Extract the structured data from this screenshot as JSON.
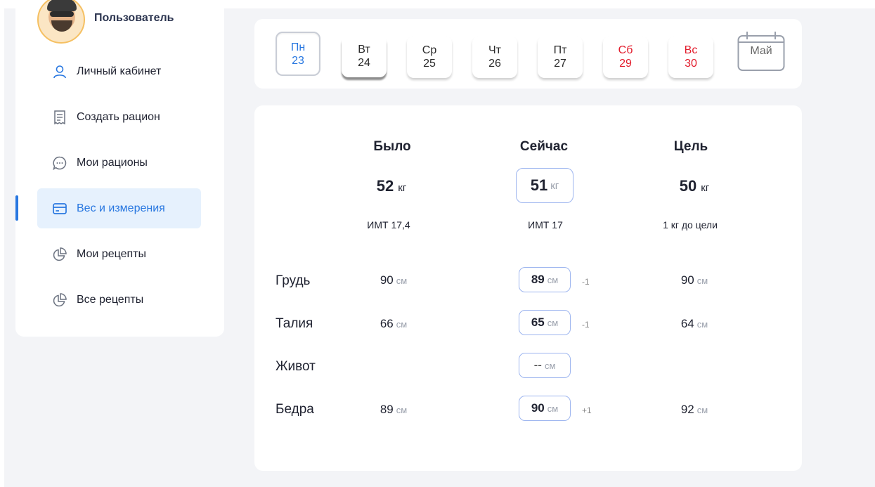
{
  "user": {
    "name": "Пользователь"
  },
  "nav": [
    {
      "label": "Личный кабинет",
      "icon": "user-icon"
    },
    {
      "label": "Создать рацион",
      "icon": "receipt-icon"
    },
    {
      "label": "Мои рационы",
      "icon": "chat-bubble-icon"
    },
    {
      "label": "Вес и измерения",
      "icon": "card-icon",
      "active": true
    },
    {
      "label": "Мои рецепты",
      "icon": "pie-chart-icon"
    },
    {
      "label": "Все рецепты",
      "icon": "pie-chart-icon"
    }
  ],
  "days": [
    {
      "name": "Пн",
      "num": "23",
      "selected": true
    },
    {
      "name": "Вт",
      "num": "24"
    },
    {
      "name": "Ср",
      "num": "25"
    },
    {
      "name": "Чт",
      "num": "26"
    },
    {
      "name": "Пт",
      "num": "27"
    },
    {
      "name": "Сб",
      "num": "29",
      "weekend": true
    },
    {
      "name": "Вс",
      "num": "30",
      "weekend": true
    }
  ],
  "month": "Май",
  "columns": {
    "was": "Было",
    "now": "Сейчас",
    "goal": "Цель"
  },
  "weight": {
    "was": "52",
    "now": "51",
    "goal": "50",
    "unit": "кг",
    "was_bmi": "ИМТ 17,4",
    "now_bmi": "ИМТ 17",
    "goal_note": "1 кг до цели"
  },
  "measure_unit": "см",
  "measurements": [
    {
      "label": "Грудь",
      "was": "90",
      "now": "89",
      "delta": "-1",
      "goal": "90"
    },
    {
      "label": "Талия",
      "was": "66",
      "now": "65",
      "delta": "-1",
      "goal": "64"
    },
    {
      "label": "Живот",
      "was": "",
      "now": "--",
      "delta": "",
      "goal": ""
    },
    {
      "label": "Бедра",
      "was": "89",
      "now": "90",
      "delta": "+1",
      "goal": "92"
    }
  ],
  "colors": {
    "accent": "#2877e0",
    "weekend": "#e21b2b",
    "active_bg": "#e6f1fd",
    "input_border": "#9db5ef"
  }
}
